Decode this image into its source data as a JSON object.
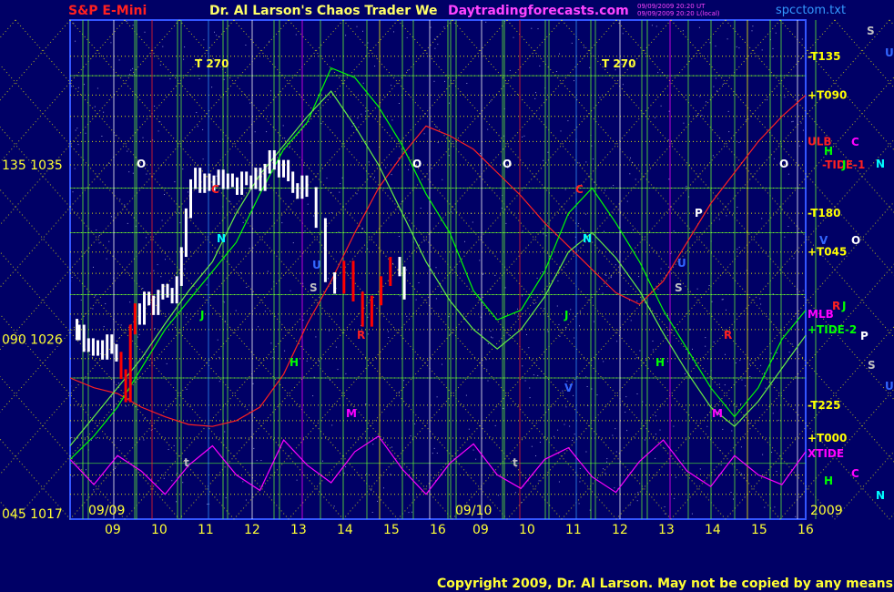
{
  "header": {
    "symbol": "S&P E-Mini",
    "title": "Dr. Al Larson's Chaos Trader We",
    "site": "Daytradingforecasts.com",
    "timestamp_line1": "09/09/2009 20:20 UT",
    "timestamp_line2": "09/09/2009 20:20 L(local)",
    "file": "spcctom.txt"
  },
  "footer": {
    "copyright": "Copyright 2009, Dr. Al Larson. May not be copied by any means."
  },
  "colors": {
    "background": "#000066",
    "price_up": "#ffffff",
    "price_down": "#ff0000",
    "ulb": "#ff2020",
    "mlb": "#ff00ff",
    "tide": "#00ff00",
    "xtide": "#ff00ff",
    "grid_yellow": "#ffff00",
    "grid_green": "#66ff33"
  },
  "chart_data": {
    "type": "line",
    "title": "S&P E-Mini",
    "xlabel": "",
    "ylabel": "",
    "ylim": [
      1017,
      1042
    ],
    "y_tick_labels": [
      {
        "angle": "045",
        "price": "1017",
        "value": 1017
      },
      {
        "angle": "090",
        "price": "1026",
        "value": 1026
      },
      {
        "angle": "135",
        "price": "1035",
        "value": 1035
      }
    ],
    "x_hour_labels": [
      "09",
      "10",
      "11",
      "12",
      "13",
      "14",
      "15",
      "16",
      "09",
      "10",
      "11",
      "12",
      "13",
      "14",
      "15",
      "16"
    ],
    "date_labels": [
      "09/09",
      "09/10",
      "2009"
    ],
    "right_labels": [
      {
        "text": "-T135",
        "color": "#ffff00",
        "value": 1040.6
      },
      {
        "text": "+T090",
        "color": "#ffff00",
        "value": 1038.6
      },
      {
        "text": "ULB",
        "color": "#ff2020",
        "value": 1036.2
      },
      {
        "text": "-TIDE-1",
        "color": "#ff2020",
        "value": 1035
      },
      {
        "text": "-T180",
        "color": "#ffff00",
        "value": 1032.5
      },
      {
        "text": "+T045",
        "color": "#ffff00",
        "value": 1030.5
      },
      {
        "text": "MLB",
        "color": "#ff00ff",
        "value": 1027.3
      },
      {
        "text": "+TIDE-2",
        "color": "#00ff00",
        "value": 1026.5
      },
      {
        "text": "-T225",
        "color": "#ffff00",
        "value": 1022.6
      },
      {
        "text": "+T000",
        "color": "#ffff00",
        "value": 1020.9
      },
      {
        "text": "XTIDE",
        "color": "#ff00ff",
        "value": 1020.1
      }
    ],
    "far_right_letters": [
      {
        "text": "S",
        "color": "#c0c0c0"
      },
      {
        "text": "U",
        "color": "#3366ff"
      },
      {
        "text": "H",
        "color": "#00ff00"
      },
      {
        "text": "C",
        "color": "#ff00ff"
      },
      {
        "text": "N",
        "color": "#00ffff"
      },
      {
        "text": "V",
        "color": "#3366ff"
      },
      {
        "text": "J",
        "color": "#00ff00"
      },
      {
        "text": "O",
        "color": "#ffffff"
      },
      {
        "text": "R",
        "color": "#ff2020"
      },
      {
        "text": "P",
        "color": "#ffffff"
      },
      {
        "text": "S",
        "color": "#c0c0c0"
      },
      {
        "text": "U",
        "color": "#3366ff"
      },
      {
        "text": "H",
        "color": "#00ff00"
      },
      {
        "text": "C",
        "color": "#ff00ff"
      },
      {
        "text": "N",
        "color": "#00ffff"
      },
      {
        "text": "J",
        "color": "#00ff00"
      }
    ],
    "t_markers": [
      "T 270",
      "T 270"
    ],
    "series": [
      {
        "name": "Price",
        "color": "#ffffff",
        "x": [
          0,
          0.05,
          0.1,
          0.2,
          0.3,
          0.4,
          0.5,
          0.6,
          0.7,
          0.8,
          0.9,
          1.0,
          1.1,
          1.2,
          1.3,
          1.4,
          1.5,
          1.6,
          1.7,
          1.8,
          1.9,
          2.0,
          2.1,
          2.2,
          2.3,
          2.4,
          2.5,
          2.6,
          2.7,
          2.8,
          2.9,
          3.0,
          3.1,
          3.2,
          3.3,
          3.4,
          3.5,
          3.6,
          3.7,
          3.8,
          3.9,
          4.0,
          4.1,
          4.2,
          4.3,
          4.4,
          4.5,
          4.6,
          4.7,
          4.8,
          4.9,
          5.0,
          5.2,
          5.4,
          5.6,
          5.8,
          6.0,
          6.2,
          6.4,
          6.6,
          6.8,
          7.0,
          7.1
        ],
        "values": [
          1026.8,
          1026.2,
          1026.5,
          1025.6,
          1025.8,
          1025.4,
          1025.7,
          1025.2,
          1026.0,
          1025.5,
          1025.1,
          1024.2,
          1023.0,
          1026.5,
          1027.6,
          1027.0,
          1028.2,
          1028.0,
          1027.5,
          1028.3,
          1028.6,
          1028.4,
          1028.1,
          1029.0,
          1030.5,
          1032.5,
          1034.0,
          1034.6,
          1033.8,
          1034.3,
          1033.9,
          1034.2,
          1034.5,
          1034.0,
          1034.3,
          1034.1,
          1033.7,
          1034.4,
          1034.2,
          1034.0,
          1034.6,
          1033.9,
          1034.8,
          1035.5,
          1035.0,
          1034.6,
          1035.0,
          1034.4,
          1033.8,
          1033.5,
          1034.2,
          1033.6,
          1032.0,
          1029.2,
          1028.6,
          1029.8,
          1028.2,
          1026.9,
          1028.0,
          1029.0,
          1030.0,
          1029.5,
          1028.3
        ]
      },
      {
        "name": "ULB",
        "color": "#ff2020",
        "values": [
          1024.0,
          1023.5,
          1023.2,
          1022.5,
          1022.0,
          1021.6,
          1021.5,
          1021.8,
          1022.5,
          1024.2,
          1026.8,
          1029.0,
          1031.5,
          1033.8,
          1035.5,
          1037.0,
          1036.5,
          1035.8,
          1034.6,
          1033.4,
          1032.0,
          1030.8,
          1029.6,
          1028.4,
          1027.8,
          1029.0,
          1031.0,
          1033.0,
          1034.6,
          1036.2,
          1037.5,
          1038.6
        ]
      },
      {
        "name": "TIDE",
        "color": "#00ff00",
        "values": [
          1019.8,
          1021.0,
          1022.5,
          1024.5,
          1026.5,
          1028.0,
          1029.5,
          1031.0,
          1033.5,
          1035.8,
          1037.2,
          1040.0,
          1039.5,
          1038.0,
          1036.0,
          1033.5,
          1031.5,
          1028.5,
          1027.0,
          1027.5,
          1029.5,
          1032.5,
          1033.8,
          1032.0,
          1030.0,
          1027.5,
          1025.5,
          1023.5,
          1022.0,
          1023.5,
          1026.0,
          1027.5
        ]
      },
      {
        "name": "TIDE-2",
        "color": "#66ee44",
        "values": [
          1020.5,
          1022.0,
          1023.5,
          1025.0,
          1026.8,
          1028.5,
          1030.0,
          1032.5,
          1034.5,
          1036.0,
          1037.5,
          1038.8,
          1037.0,
          1035.0,
          1032.5,
          1030.0,
          1028.0,
          1026.5,
          1025.5,
          1026.5,
          1028.2,
          1030.5,
          1031.5,
          1030.2,
          1028.5,
          1026.3,
          1024.3,
          1022.5,
          1021.5,
          1022.8,
          1024.5,
          1026.2
        ]
      },
      {
        "name": "XTIDE",
        "color": "#ff00ff",
        "values": [
          1019.8,
          1018.5,
          1020.0,
          1019.2,
          1018.0,
          1019.5,
          1020.5,
          1019.0,
          1018.2,
          1020.8,
          1019.5,
          1018.6,
          1020.2,
          1021.0,
          1019.3,
          1018.0,
          1019.6,
          1020.6,
          1019.0,
          1018.3,
          1019.8,
          1020.4,
          1018.9,
          1018.1,
          1019.7,
          1020.8,
          1019.2,
          1018.4,
          1020.0,
          1019.0,
          1018.5,
          1020.2
        ]
      }
    ]
  },
  "chart_letters": [
    {
      "text": "O",
      "color": "#ffffff"
    },
    {
      "text": "O",
      "color": "#ffffff"
    },
    {
      "text": "O",
      "color": "#ffffff"
    },
    {
      "text": "O",
      "color": "#ffffff"
    },
    {
      "text": "C",
      "color": "#ff2020"
    },
    {
      "text": "C",
      "color": "#ff2020"
    },
    {
      "text": "N",
      "color": "#00ffff"
    },
    {
      "text": "N",
      "color": "#00ffff"
    },
    {
      "text": "J",
      "color": "#00ff00"
    },
    {
      "text": "J",
      "color": "#00ff00"
    },
    {
      "text": "U",
      "color": "#3366ff"
    },
    {
      "text": "U",
      "color": "#3366ff"
    },
    {
      "text": "S",
      "color": "#c0c0c0"
    },
    {
      "text": "S",
      "color": "#c0c0c0"
    },
    {
      "text": "R",
      "color": "#ff2020"
    },
    {
      "text": "R",
      "color": "#ff2020"
    },
    {
      "text": "H",
      "color": "#00ff00"
    },
    {
      "text": "H",
      "color": "#00ff00"
    },
    {
      "text": "M",
      "color": "#ff00ff"
    },
    {
      "text": "M",
      "color": "#ff00ff"
    },
    {
      "text": "V",
      "color": "#3366ff"
    },
    {
      "text": "P",
      "color": "#ffffff"
    },
    {
      "text": "t",
      "color": "#c0c0c0"
    },
    {
      "text": "t",
      "color": "#c0c0c0"
    }
  ]
}
